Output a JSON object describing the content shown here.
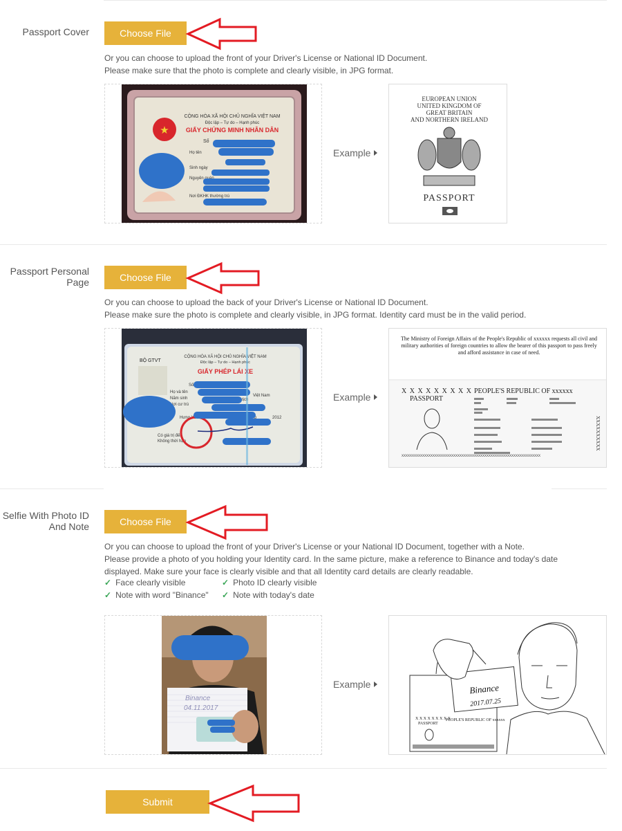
{
  "sections": [
    {
      "label": "Passport Cover",
      "button": "Choose File",
      "desc": [
        "Or you can choose to upload the front of your Driver's License or National ID Document.",
        "Please make sure that the photo is complete and clearly visible, in JPG format."
      ],
      "example_label": "Example",
      "example_doc": {
        "title_lines": [
          "EUROPEAN UNION",
          "UNITED KINGDOM OF",
          "GREAT BRITAIN",
          "AND NORTHERN IRELAND"
        ],
        "word": "PASSPORT"
      },
      "card": {
        "header": "CỘNG HÒA XÃ HỘI CHỦ NGHĨA VIỆT NAM",
        "subheader": "Độc lập – Tự do – Hạnh phúc",
        "title": "GIẤY CHỨNG MINH NHÂN DÂN",
        "fields": [
          "Số",
          "Họ tên",
          "Sinh ngày",
          "Nguyên quán",
          "Nơi ĐKHK thường trú"
        ]
      }
    },
    {
      "label": "Passport Personal Page",
      "button": "Choose File",
      "desc": [
        "Or you can choose to upload the back of your Driver's License or National ID Document.",
        "Please make sure the photo is complete and clearly visible, in JPG format. Identity card must be in the valid period."
      ],
      "example_label": "Example",
      "example_doc": {
        "text": "The Ministry of Foreign Affairs of the People's Republic of xxxxxx requests all civil and military authorities of foreign countries to allow the bearer of this passport to pass freely and afford assistance in case of need.",
        "xrow": "X X X X X X X X X",
        "passport": "PASSPORT",
        "country": "PEOPLE'S REPUBLIC OF xxxxxx",
        "mrz": "XXXXXXXXXXXXXXXXXXXXXXXXXXXXXXXXXXXXXXXXXXXXXXXXXXXXXXXXXXXXXXXXXXX"
      },
      "card": {
        "corner": "BỘ GTVT",
        "header": "CỘNG HÒA XÃ HỘI CHỦ NGHĨA VIỆT NAM",
        "subheader": "Độc lập – Tự do – Hạnh phúc",
        "title": "GIẤY PHÉP LÁI XE",
        "fields": [
          "Số",
          "Họ và tên",
          "Năm sinh",
          "Nơi cư trú",
          "Việt Nam",
          "Quốc tịch",
          "tháng",
          "2012",
          "Có giá trị đến",
          "Không thời hạn",
          "Hưng Yên"
        ]
      }
    },
    {
      "label": "Selfie With Photo ID And Note",
      "button": "Choose File",
      "desc": [
        "Or you can choose to upload the front of your Driver's License or your National ID Document, together with a Note.",
        "Please provide a photo of you holding your Identity card. In the same picture, make a reference to Binance and today's date",
        "displayed. Make sure your face is clearly visible and that all Identity card details are clearly readable."
      ],
      "checks": [
        "Face clearly visible",
        "Photo ID clearly visible",
        "Note with word \"Binance\"",
        "Note with today's date"
      ],
      "example_label": "Example",
      "example_doc": {
        "note_word": "Binance",
        "note_date": "2017.07.25",
        "passport": "PASSPORT",
        "country": "PEOPLE'S REPUBLIC OF xxxxxx",
        "xrow": "X X X X X X X X X"
      },
      "selfie_note": {
        "word": "Binance",
        "date": "04.11.2017"
      }
    }
  ],
  "submit": "Submit",
  "colors": {
    "button": "#e6b23a",
    "arrow": "#e31b23",
    "check": "#3aa657",
    "redact": "#2f72c9"
  }
}
